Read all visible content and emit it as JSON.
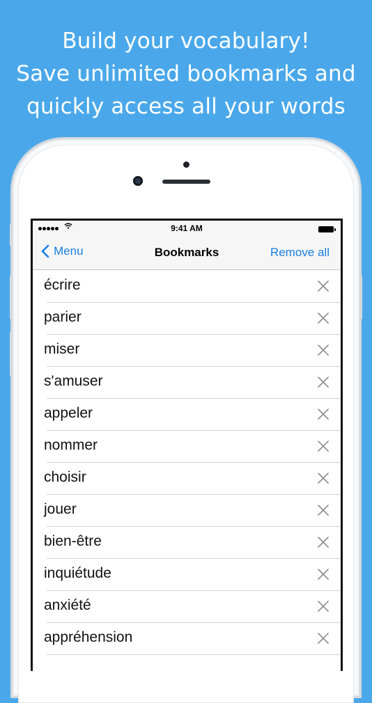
{
  "headline": {
    "line1": "Build your vocabulary!",
    "line2": "Save unlimited bookmarks and",
    "line3": "quickly access all your words"
  },
  "status_bar": {
    "time": "9:41 AM"
  },
  "nav": {
    "back_label": "Menu",
    "title": "Bookmarks",
    "action_label": "Remove all"
  },
  "bookmarks": [
    "écrire",
    "parier",
    "miser",
    "s'amuser",
    "appeler",
    "nommer",
    "choisir",
    "jouer",
    "bien-être",
    "inquiétude",
    "anxiété",
    "appréhension"
  ],
  "colors": {
    "background": "#4aa8ea",
    "accent": "#1a7fe1"
  },
  "icons": {
    "back": "chevron-left-icon",
    "delete": "close-icon",
    "wifi": "wifi-icon"
  }
}
